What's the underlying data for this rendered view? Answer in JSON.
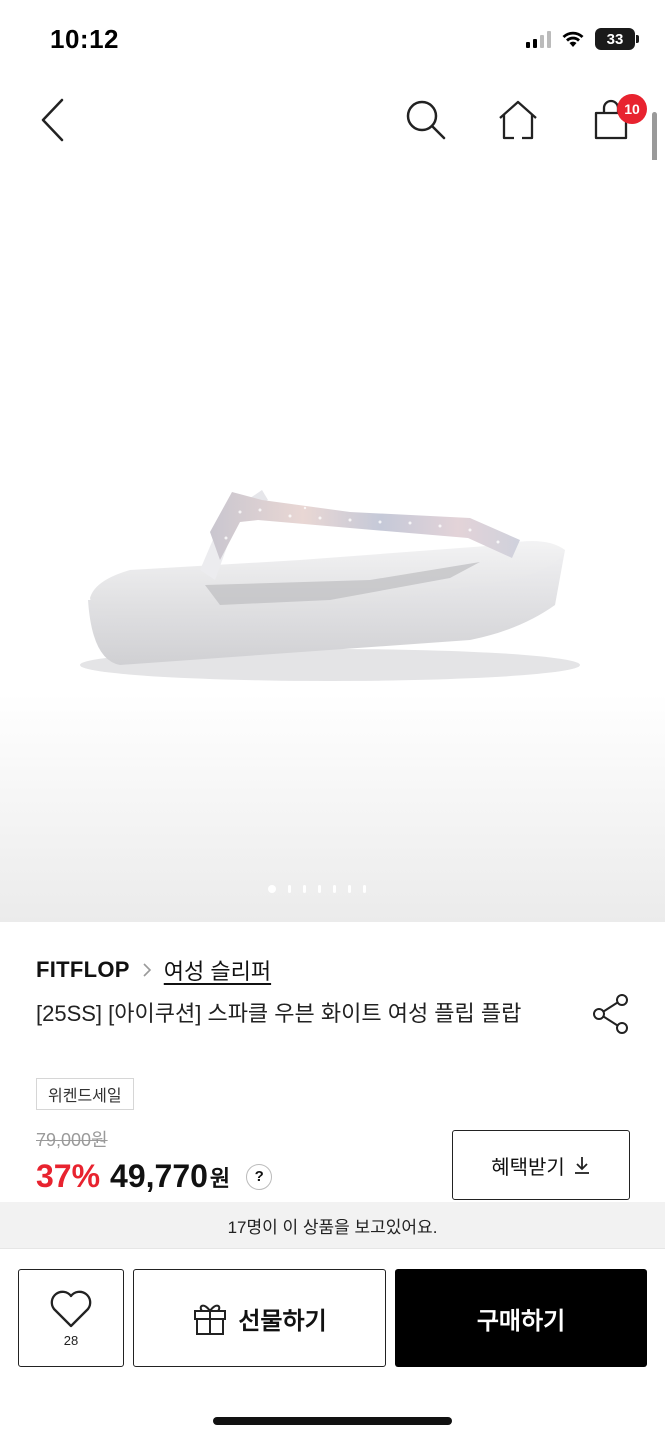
{
  "status_bar": {
    "time": "10:12",
    "battery": "33",
    "icons": [
      "signal-icon",
      "wifi-icon",
      "battery-icon"
    ]
  },
  "nav": {
    "back_icon": "chevron-left-icon",
    "search_icon": "search-icon",
    "home_icon": "home-icon",
    "cart_icon": "shopping-bag-icon",
    "cart_count": "10"
  },
  "gallery": {
    "image": "white flip flop sandal with sparkle strap",
    "total_slides": 7,
    "active_slide": 1
  },
  "product": {
    "brand": "FITFLOP",
    "category": "여성 슬리퍼",
    "title": "[25SS] [아이쿠션] 스파클 우븐 화이트 여성 플립 플랍",
    "tag": "위켄드세일",
    "original_price": "79,000원",
    "discount": "37%",
    "price": "49,770",
    "currency": "원",
    "help_label": "?"
  },
  "benefit_button": {
    "label": "혜택받기"
  },
  "viewers_text": "17명이 이 상품을 보고있어요.",
  "bottom_bar": {
    "wish_count": "28",
    "gift_label": "선물하기",
    "buy_label": "구매하기"
  },
  "colors": {
    "accent_red": "#e8232f",
    "buy_button": "#000000"
  }
}
